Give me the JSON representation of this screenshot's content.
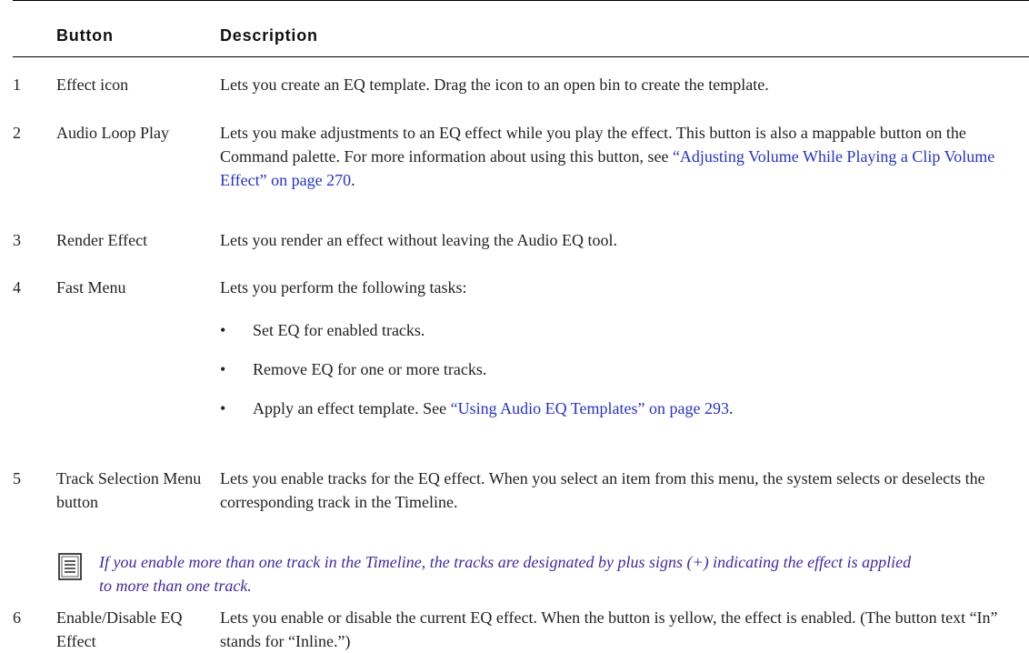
{
  "table": {
    "headers": {
      "button": "Button",
      "description": "Description"
    },
    "rows": [
      {
        "num": "1",
        "button": "Effect icon",
        "desc": "Lets you create an EQ template. Drag the icon to an open bin to create the template."
      },
      {
        "num": "2",
        "button": "Audio Loop Play",
        "desc_lead": "Lets you make adjustments to an EQ effect while you play the effect. This button is also a mappable button on the Command palette. For more information about using this button, see ",
        "desc_link": "“Adjusting Volume While Playing a Clip Volume Effect” on page 270",
        "desc_tail": "."
      },
      {
        "num": "3",
        "button": "Render Effect",
        "desc": "Lets you render an effect without leaving the Audio EQ tool."
      },
      {
        "num": "4",
        "button": "Fast Menu",
        "desc": "Lets you perform the following tasks:",
        "bullet_char": "•",
        "bullets": [
          {
            "text": "Set EQ for enabled tracks."
          },
          {
            "text": "Remove EQ for one or more tracks."
          },
          {
            "lead": "Apply an effect template. See ",
            "link": "“Using Audio EQ Templates” on page 293",
            "tail": "."
          }
        ]
      },
      {
        "num": "5",
        "button": "Track Selection Menu button",
        "desc": "Lets you enable tracks for the EQ effect. When you select an item from this menu, the system selects or deselects the corresponding track in the Timeline."
      },
      {
        "num": "6",
        "button": "Enable/Disable EQ Effect",
        "desc": "Lets you enable or disable the current EQ effect. When the button is yellow, the effect is enabled. (The button text “In” stands for “Inline.”)"
      }
    ]
  },
  "note": {
    "icon": "note-icon",
    "text": "If you enable more than one track in the Timeline, the tracks are designated by plus signs (+) indicating the effect is applied to more than one track."
  }
}
